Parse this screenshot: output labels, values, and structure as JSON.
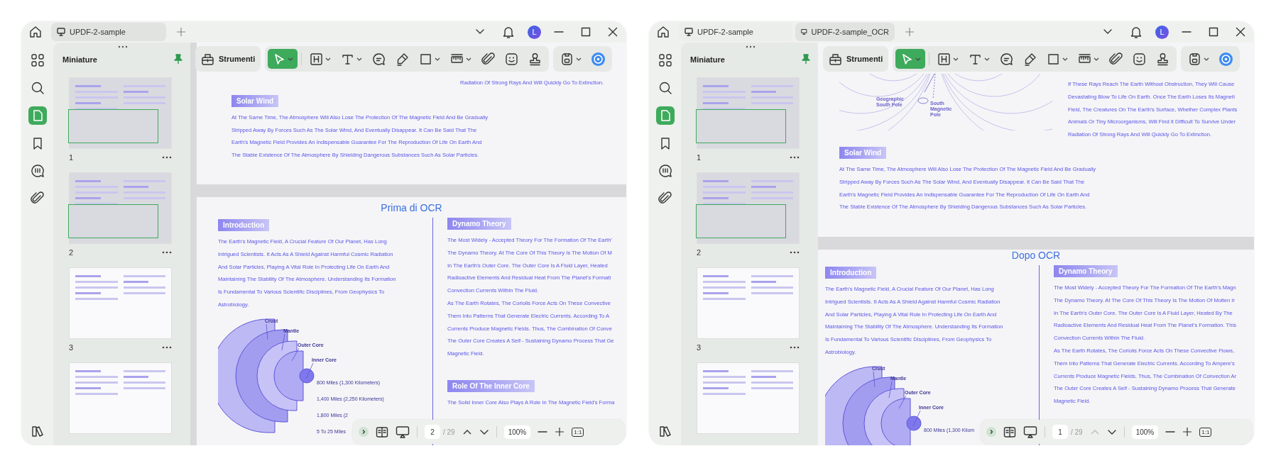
{
  "windows": [
    {
      "tabs": [
        {
          "label": "UPDF-2-sample",
          "selected": true
        }
      ],
      "avatar": "L",
      "rail": [
        {
          "selected": false
        },
        {
          "selected": false
        },
        {
          "selected": true
        },
        {
          "selected": false
        },
        {
          "selected": false
        },
        {
          "selected": false
        }
      ],
      "panel": {
        "title": "Miniature",
        "thumbnails": [
          {
            "label": "1",
            "in_view": true
          },
          {
            "label": "2",
            "in_view": true
          },
          {
            "label": "3",
            "in_view": false
          },
          {
            "in_view": false
          }
        ]
      },
      "toolbar": {
        "label": "Strumenti",
        "tools": [
          {
            "selected": true,
            "caret": true
          },
          {
            "selected": false,
            "caret": true
          },
          {
            "selected": false,
            "caret": true
          },
          {
            "selected": false,
            "caret": false
          },
          {
            "selected": false,
            "caret": false
          },
          {
            "selected": false,
            "caret": true
          },
          {
            "selected": false,
            "caret": true
          },
          {
            "selected": false,
            "caret": false
          },
          {
            "selected": false,
            "caret": false
          },
          {
            "selected": false,
            "caret": false
          }
        ],
        "file_tools": [
          {
            "selected": false,
            "caret": true
          },
          {
            "selected": false,
            "caret": false
          }
        ]
      },
      "pages": [
        {
          "kind": "section_end",
          "side_lines": [
            "Radiation Of Strong Rays And Will Quickly Go To Extinction."
          ],
          "heading": "Solar Wind",
          "lines": [
            "At The Same Time, The Atmosphere Will Also Lose The Protection Of The Magnetic Field And Be Gradually",
            "Stripped Away By Forces Such As The Solar Wind, And Eventually Disappear. It Can Be Said That The",
            "Earth's Magnetic Field Provides An Indispensable Guarantee For The Reproduction Of Life On Earth And",
            "The Stable Existence Of The Atmosphere By Shielding Dangerous Substances Such As Solar Particles."
          ]
        },
        {
          "kind": "columns",
          "title": "Prima di OCR",
          "left": {
            "heading": "Introduction",
            "lines": [
              "The Earth's Magnetic Field, A Crucial Feature Of Our Planet, Has Long",
              "Intrigued Scientists. It Acts As A Shield Against Harmful Cosmic Radiation",
              "And Solar Particles, Playing A Vital Role In Protecting Life On Earth And",
              "Maintaining The Stability Of The Atmosphere. Understanding Its Formation",
              "Is Fundamental To Various Scientific Disciplines, From Geophysics To",
              "Astrobiology."
            ],
            "layer_labels": [
              "Crust",
              "Mantle",
              "Outer Core",
              "Inner Core"
            ],
            "distance_labels": [
              "800 Miles (1,300 Kilometers)",
              "1,400 Miles (2,250 Kilometers)",
              "1,800 Miles (2",
              "5 To 25 Miles"
            ]
          },
          "right": [
            {
              "heading": "Dynamo Theory",
              "lines": [
                "The Most Widely - Accepted Theory For The Formation Of The Earth'",
                "The Dynamo Theory. At The Core Of This Theory Is The Motion Of M",
                "In The Earth's Outer Core. The Outer Core Is A Fluid Layer, Heated",
                "Radioactive Elements And Residual Heat From The Planet's Formati",
                "Convection Currents Within The Fluid.",
                "As The Earth Rotates, The Coriolis Force Acts On These Convective",
                "Them Into Patterns That Generate Electric Currents. According To A",
                "Currents Produce Magnetic Fields. Thus, The Combination Of Conve",
                "The Outer Core Creates A Self - Sustaining Dynamo Process That Ge",
                "Magnetic Field."
              ]
            },
            {
              "heading": "Role Of The Inner Core",
              "lines": [
                "The Solid Inner Core Also Plays A Role In The Magnetic Field's Forma"
              ]
            }
          ]
        }
      ],
      "nav": {
        "page": "2",
        "total": "/ 29",
        "zoom": "100%",
        "actual_size": "1:1",
        "prev_disabled": false
      }
    },
    {
      "tabs": [
        {
          "label": "UPDF-2-sample",
          "selected": false
        },
        {
          "label": "UPDF-2-sample_OCR",
          "selected": true
        }
      ],
      "avatar": "L",
      "rail": [
        {
          "selected": false
        },
        {
          "selected": false
        },
        {
          "selected": true
        },
        {
          "selected": false
        },
        {
          "selected": false
        },
        {
          "selected": false
        }
      ],
      "panel": {
        "title": "Miniature",
        "thumbnails": [
          {
            "label": "1",
            "in_view": true
          },
          {
            "label": "2",
            "in_view": true
          },
          {
            "label": "3",
            "in_view": false
          },
          {
            "in_view": false
          }
        ]
      },
      "toolbar": {
        "label": "Strumenti",
        "tools": [
          {
            "selected": true,
            "caret": true
          },
          {
            "selected": false,
            "caret": true
          },
          {
            "selected": false,
            "caret": true
          },
          {
            "selected": false,
            "caret": false
          },
          {
            "selected": false,
            "caret": false
          },
          {
            "selected": false,
            "caret": true
          },
          {
            "selected": false,
            "caret": true
          },
          {
            "selected": false,
            "caret": false
          },
          {
            "selected": false,
            "caret": false
          },
          {
            "selected": false,
            "caret": false
          }
        ],
        "file_tools": [
          {
            "selected": false,
            "caret": true
          },
          {
            "selected": false,
            "caret": false
          }
        ]
      },
      "pages": [
        {
          "kind": "section_end",
          "figure_labels": [
            "Geographic South Pole",
            "South Magnetic Pole"
          ],
          "side_lines": [
            "If These Rays Reach The Earth Without Obstruction, They Will Cause",
            "Devastating Blow To Life On Earth. Once The Earth Loses Its Magneti",
            "Field, The Creatures On The Earth's Surface, Whether Complex Plants",
            "Animals Or Tiny Microorganisms, Will Find It Difficult To Survive Under",
            "Radiation Of Strong Rays And Will Quickly Go To Extinction."
          ],
          "heading": "Solar Wind",
          "lines": [
            "At The Same Time, The Atmosphere Will Also Lose The Protection Of The Magnetic Field And Be Gradually",
            "Stripped Away By Forces Such As The Solar Wind, And Eventually Disappear. It Can Be Said That The",
            "Earth's Magnetic Field Provides An Indispensable Guarantee For The Reproduction Of Life On Earth And",
            "The Stable Existence Of The Atmosphere By Shielding Dangerous Substances Such As Solar Particles."
          ]
        },
        {
          "kind": "columns",
          "title": "Dopo OCR",
          "left": {
            "heading": "Introduction",
            "lines": [
              "The Earth's Magnetic Field, A Crucial Feature Of Our Planet, Has Long",
              "Intrigued Scientists. It Acts As A Shield Against Harmful Cosmic Radiation",
              "And Solar Particles, Playing A Vital Role In Protecting Life On Earth And",
              "Maintaining The Stability Of The Atmosphere. Understanding Its Formation",
              "Is Fundamental To Various Scientific Disciplines, From Geophysics To",
              "Astrobiology."
            ],
            "layer_labels": [
              "Crust",
              "Mantle",
              "Outer Core",
              "Inner Core"
            ],
            "distance_labels": [
              "800 Miles (1,300 Kilom"
            ]
          },
          "right": [
            {
              "heading": "Dynamo Theory",
              "lines": [
                "The Most Widely - Accepted Theory For The Formation Of The Earth's Magn",
                "The Dynamo Theory. At The Core Of This Theory Is The Motion Of Molten Ir",
                "In The Earth's Outer Core. The Outer Core Is A Fluid Layer, Heated By The",
                "Radioactive Elements And Residual Heat From The Planet's Formation. This",
                "Convection Currents Within The Fluid.",
                "As The Earth Rotates, The Coriolis Force Acts On These Convective Flows,",
                "Them Into Patterns That Generate Electric Currents. According To Ampere's",
                "Currents Produce Magnetic Fields. Thus, The Combination Of Convection Ar",
                "The Outer Core Creates A Self - Sustaining Dynamo Process That Generate",
                "Magnetic Field."
              ]
            }
          ]
        }
      ],
      "nav": {
        "page": "1",
        "total": "/ 29",
        "zoom": "100%",
        "actual_size": "1:1",
        "prev_disabled": true
      }
    }
  ]
}
